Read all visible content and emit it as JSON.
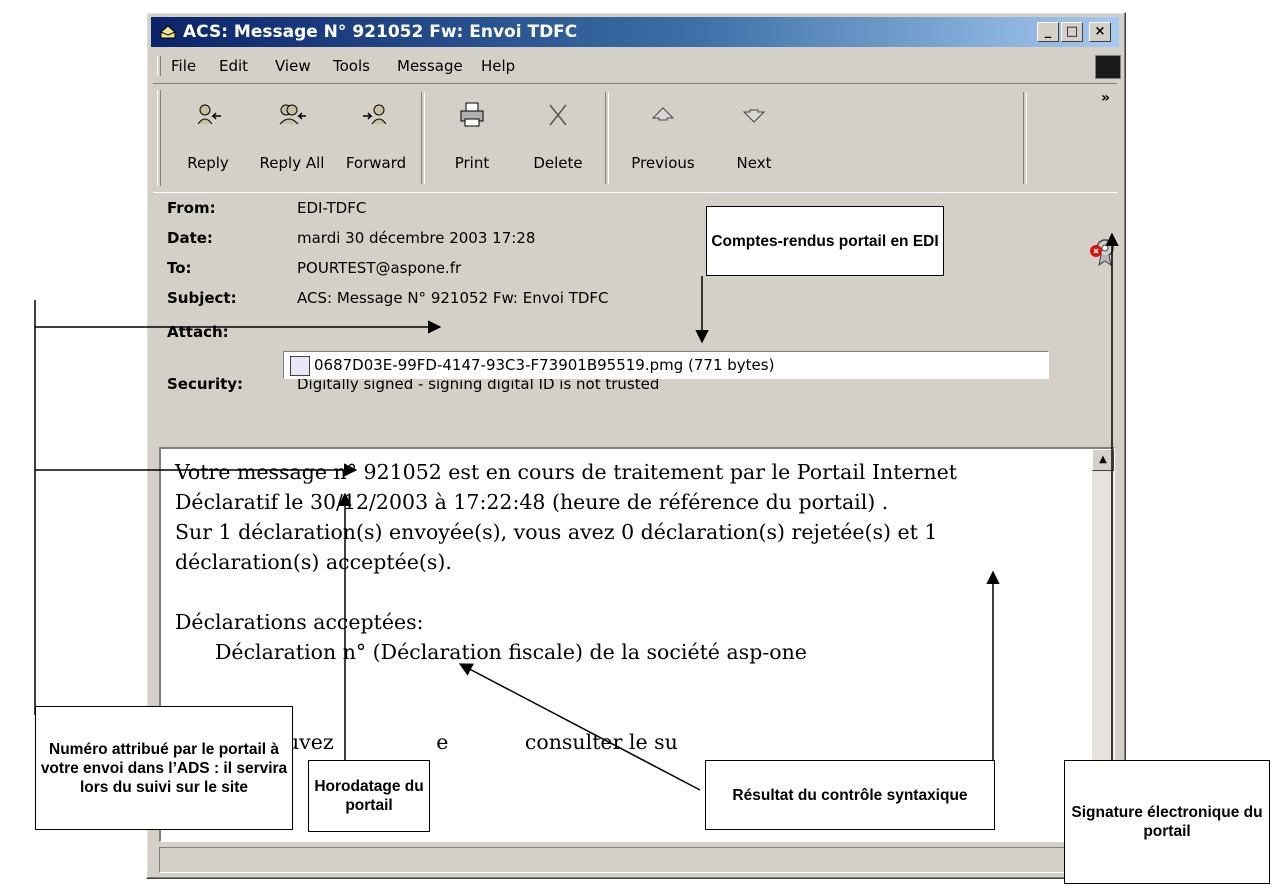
{
  "window": {
    "title": "ACS: Message N° 921052 Fw: Envoi TDFC",
    "controls": {
      "minimize": "_",
      "maximize": "□",
      "close": "×"
    }
  },
  "menu": {
    "file": "File",
    "edit": "Edit",
    "view": "View",
    "tools": "Tools",
    "message": "Message",
    "help": "Help"
  },
  "toolbar": {
    "reply": "Reply",
    "reply_all": "Reply All",
    "forward": "Forward",
    "print": "Print",
    "delete": "Delete",
    "previous": "Previous",
    "next": "Next",
    "more": "»"
  },
  "headers": {
    "from_label": "From:",
    "from_value": "EDI-TDFC",
    "date_label": "Date:",
    "date_value": "mardi 30 décembre 2003 17:28",
    "to_label": "To:",
    "to_value": "POURTEST@aspone.fr",
    "subject_label": "Subject:",
    "subject_value": "ACS: Message N° 921052 Fw: Envoi TDFC",
    "attach_label": "Attach:",
    "attach_value": "0687D03E-99FD-4147-93C3-F73901B95519.pmg (771 bytes)",
    "security_label": "Security:",
    "security_value": "Digitally signed - signing digital ID is not trusted"
  },
  "message": {
    "line1": "Votre message n° 921052 est en cours de traitement par le Portail Internet",
    "line2": "Déclaratif le 30/12/2003 à 17:22:48 (heure de référence du portail) .",
    "line3": " Sur 1 déclaration(s) envoyée(s), vous avez 0 déclaration(s) rejetée(s) et 1",
    "line4": "déclaration(s) acceptée(s).",
    "line5": "Déclarations acceptées:",
    "line6": "Déclaration n°  (Déclaration fiscale) de la société asp-one",
    "line7_start": "Vous pouvez",
    "line7_mid": "e",
    "line7_end": "consulter le su"
  },
  "callouts": {
    "comptes_rendus": "Comptes-rendus portail en EDI",
    "numero": "Numéro attribué par le portail à votre envoi dans l’ADS : il servira lors du suivi sur le site",
    "horodatage": "Horodatage du portail",
    "resultat": "Résultat du contrôle syntaxique",
    "signature": "Signature électronique du portail"
  },
  "colors": {
    "title_gradient_start": "#0a246a",
    "title_gradient_end": "#a6caf0",
    "chrome": "#d4d0c8"
  }
}
